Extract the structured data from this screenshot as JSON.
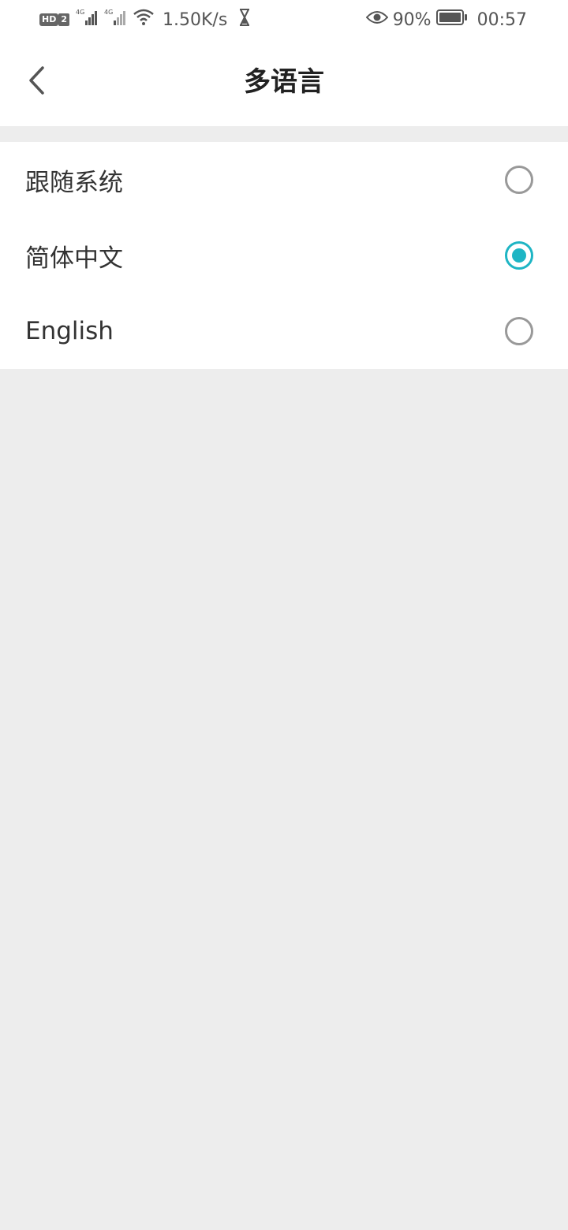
{
  "status_bar": {
    "left_icons": [
      "hd-icon",
      "sim2-icon",
      "signal-4g-icon",
      "signal-4g-2-icon",
      "wifi-icon"
    ],
    "hd_label": "HD",
    "sim_label": "2",
    "network_speed": "1.50K/s",
    "battery_percent": "90%",
    "time": "00:57"
  },
  "header": {
    "title": "多语言",
    "back_icon": "chevron-left-icon"
  },
  "languages": {
    "items": [
      {
        "label": "跟随系统",
        "selected": false
      },
      {
        "label": "简体中文",
        "selected": true
      },
      {
        "label": "English",
        "selected": false
      }
    ]
  },
  "colors": {
    "accent": "#1eb5c4",
    "background": "#ededed",
    "surface": "#ffffff"
  }
}
